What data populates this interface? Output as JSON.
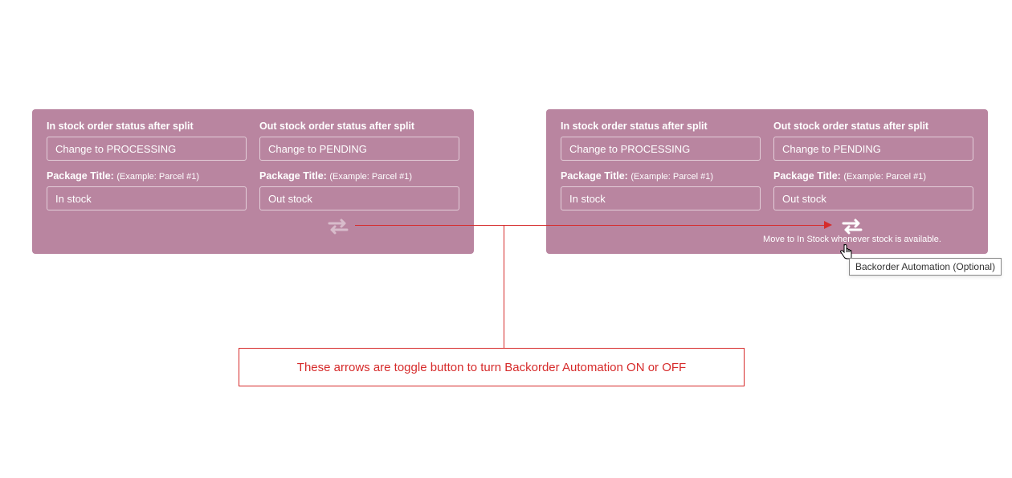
{
  "panels": {
    "left": {
      "in_status": {
        "label": "In stock order status after split",
        "value": "Change to PROCESSING"
      },
      "out_status": {
        "label": "Out stock order status after split",
        "value": "Change to PENDING"
      },
      "in_title": {
        "label": "Package Title:",
        "example": "(Example: Parcel #1)",
        "value": "In stock"
      },
      "out_title": {
        "label": "Package Title:",
        "example": "(Example: Parcel #1)",
        "value": "Out stock"
      }
    },
    "right": {
      "in_status": {
        "label": "In stock order status after split",
        "value": "Change to PROCESSING"
      },
      "out_status": {
        "label": "Out stock order status after split",
        "value": "Change to PENDING"
      },
      "in_title": {
        "label": "Package Title:",
        "example": "(Example: Parcel #1)",
        "value": "In stock"
      },
      "out_title": {
        "label": "Package Title:",
        "example": "(Example: Parcel #1)",
        "value": "Out stock"
      },
      "helper": "Move to In Stock whenever stock is available."
    }
  },
  "note": "These arrows are toggle button to turn Backorder Automation ON or OFF",
  "tooltip": "Backorder Automation (Optional)"
}
